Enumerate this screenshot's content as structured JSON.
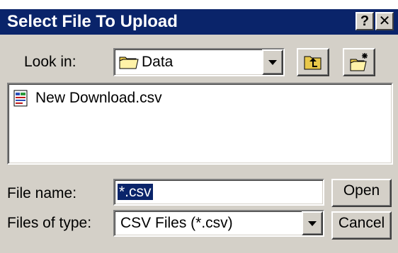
{
  "dialog": {
    "title": "Select File To Upload",
    "help_glyph": "?",
    "close_glyph": "✕"
  },
  "look_in": {
    "label": "Look in:",
    "selected": "Data",
    "folder_icon": "folder-icon"
  },
  "toolbar": {
    "up_icon": "up-one-level-icon",
    "new_folder_icon": "new-folder-icon"
  },
  "file_list": {
    "items": [
      {
        "name": "New Download.csv",
        "icon": "csv-file-icon"
      }
    ]
  },
  "file_name": {
    "label": "File name:",
    "value": "*.csv"
  },
  "file_type": {
    "label": "Files of type:",
    "selected": "CSV Files (*.csv)"
  },
  "buttons": {
    "open": "Open",
    "cancel": "Cancel"
  },
  "colors": {
    "titlebar": "#0a246a",
    "face": "#d4d0c8",
    "selection": "#0a246a"
  }
}
